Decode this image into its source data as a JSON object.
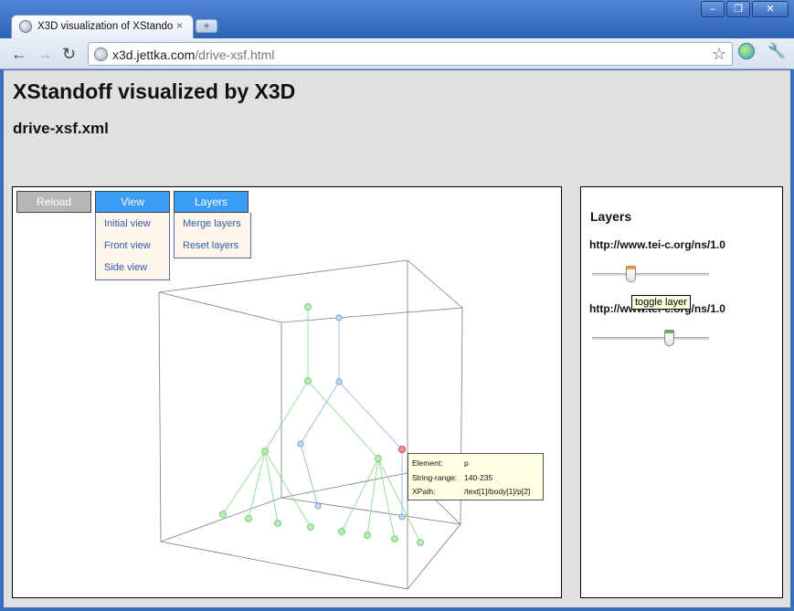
{
  "browser": {
    "tab_title": "X3D visualization of XStandoff",
    "tab_close": "×",
    "new_tab": "+",
    "window_buttons": [
      "–",
      "❐",
      "✕"
    ],
    "url_host": "x3d.jettka.com",
    "url_path": "/drive-xsf.html",
    "back": "←",
    "forward": "→",
    "reload": "↻",
    "star": "☆",
    "wrench": "🔧"
  },
  "page": {
    "title": "XStandoff visualized by X3D",
    "subtitle": "drive-xsf.xml"
  },
  "viewer": {
    "reload_label": "Reload",
    "view_label": "View",
    "layers_label": "Layers",
    "view_menu": [
      "Initial view",
      "Front view",
      "Side view"
    ],
    "layers_menu": [
      "Merge layers",
      "Reset layers"
    ],
    "tooltip": [
      {
        "key": "Element:",
        "value": "p"
      },
      {
        "key": "String-range:",
        "value": "140-235"
      },
      {
        "key": "XPath:",
        "value": "/text[1]/body[1]/p[2]"
      }
    ],
    "colors": {
      "green_layer": "#7bd67b",
      "blue_layer": "#8eb5e8",
      "selected_node": "#ef6f78"
    }
  },
  "panel": {
    "title": "Layers",
    "layers": [
      {
        "name": "http://www.tei-c.org/ns/1.0",
        "slider_value": 0.33,
        "thumb_color": "#f0a030"
      },
      {
        "name": "http://www.tei-c.org/ns/1.0",
        "slider_value": 0.66,
        "thumb_color": "#4cc24c"
      }
    ],
    "hover_hint": "toggle layer"
  }
}
